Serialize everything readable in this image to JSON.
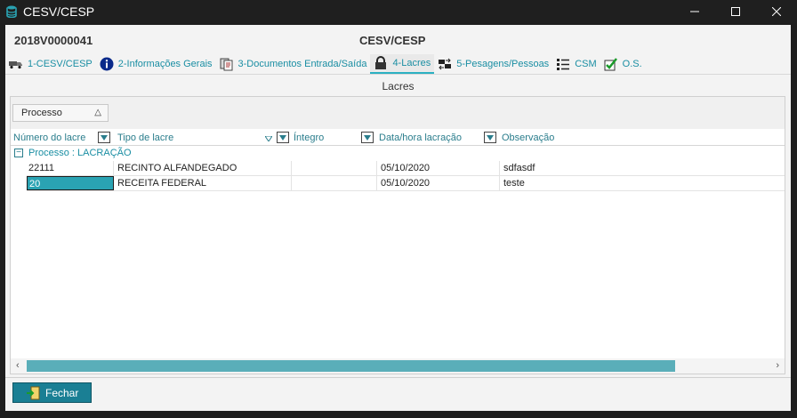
{
  "window": {
    "title": "CESV/CESP",
    "controls": [
      "minimize-icon",
      "maximize-icon",
      "close-icon"
    ]
  },
  "header": {
    "process_id": "2018V0000041",
    "heading": "CESV/CESP"
  },
  "tabs": [
    {
      "label": "1-CESV/CESP",
      "icon": "truck-icon"
    },
    {
      "label": "2-Informações Gerais",
      "icon": "info-icon"
    },
    {
      "label": "3-Documentos Entrada/Saída",
      "icon": "documents-icon"
    },
    {
      "label": "4-Lacres",
      "icon": "lock-icon",
      "active": true
    },
    {
      "label": "5-Pesagens/Pessoas",
      "icon": "transfer-icon"
    },
    {
      "label": "CSM",
      "icon": "checklist-icon"
    },
    {
      "label": "O.S.",
      "icon": "checkmark-icon"
    }
  ],
  "panel": {
    "title": "Lacres"
  },
  "grid": {
    "group_chip": "Processo",
    "columns": [
      "Número do lacre",
      "Tipo de lacre",
      "Íntegro",
      "Data/hora lacração",
      "Observação"
    ],
    "group_label": "Processo : LACRAÇÃO",
    "rows": [
      {
        "numero": "22111",
        "tipo": "RECINTO ALFANDEGADO",
        "integro": "",
        "data": "05/10/2020",
        "obs": "sdfasdf"
      },
      {
        "numero": "20",
        "tipo": "RECEITA FEDERAL",
        "integro": "",
        "data": "05/10/2020",
        "obs": "teste"
      }
    ]
  },
  "footer": {
    "close_label": "Fechar"
  },
  "colors": {
    "accent": "#1a8ea3",
    "button": "#1a7f94",
    "selection": "#2aa3b3",
    "scroll_thumb": "#5aaeb9"
  }
}
